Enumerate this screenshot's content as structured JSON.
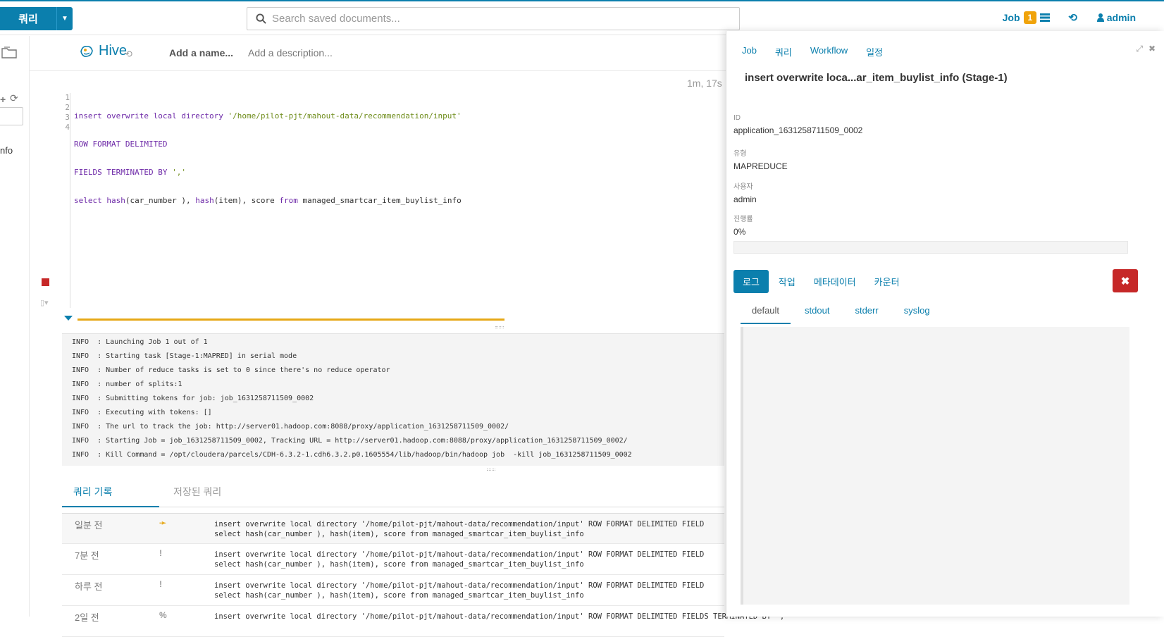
{
  "navbar": {
    "query_button": "쿼리",
    "search_placeholder": "Search saved documents...",
    "jobs_label": "Job",
    "jobs_count": "1",
    "user": "admin"
  },
  "left_strip": {
    "text": "nfo"
  },
  "editor_header": {
    "app": "Hive",
    "name_placeholder": "Add a name...",
    "desc_placeholder": "Add a description...",
    "elapsed": "1m, 17s"
  },
  "editor": {
    "line_numbers": [
      "1",
      "2",
      "3",
      "4"
    ],
    "line1_kw": "insert overwrite local directory ",
    "line1_str": "'/home/pilot-pjt/mahout-data/recommendation/input'",
    "line2": "ROW FORMAT DELIMITED",
    "line3_kw": "FIELDS TERMINATED BY ",
    "line3_str": "','",
    "line4_kw": "select ",
    "line4_fn1": "hash",
    "line4_a": "(car_number ), ",
    "line4_fn2": "hash",
    "line4_b": "(item), score ",
    "line4_kw2": "from",
    "line4_c": " managed_smartcar_item_buylist_info"
  },
  "log_lines": [
    "INFO  : Launching Job 1 out of 1",
    "INFO  : Starting task [Stage-1:MAPRED] in serial mode",
    "INFO  : Number of reduce tasks is set to 0 since there's no reduce operator",
    "INFO  : number of splits:1",
    "INFO  : Submitting tokens for job: job_1631258711509_0002",
    "INFO  : Executing with tokens: []",
    "INFO  : The url to track the job: http://server01.hadoop.com:8088/proxy/application_1631258711509_0002/",
    "INFO  : Starting Job = job_1631258711509_0002, Tracking URL = http://server01.hadoop.com:8088/proxy/application_1631258711509_0002/",
    "INFO  : Kill Command = /opt/cloudera/parcels/CDH-6.3.2-1.cdh6.3.2.p0.1605554/lib/hadoop/bin/hadoop job  -kill job_1631258711509_0002"
  ],
  "history_tabs": {
    "active": "쿼리 기록",
    "inactive": "저장된 쿼리"
  },
  "history": [
    {
      "when": "일분 전",
      "status": "➛",
      "status_color": "#e6a817",
      "line1": "insert overwrite local directory '/home/pilot-pjt/mahout-data/recommendation/input' ROW FORMAT DELIMITED FIELD",
      "line2": "select hash(car_number ), hash(item), score from managed_smartcar_item_buylist_info"
    },
    {
      "when": "7분 전",
      "status": "!",
      "status_color": "#999999",
      "line1": "insert overwrite local directory '/home/pilot-pjt/mahout-data/recommendation/input' ROW FORMAT DELIMITED FIELD",
      "line2": "select hash(car_number ), hash(item), score from managed_smartcar_item_buylist_info"
    },
    {
      "when": "하루 전",
      "status": "!",
      "status_color": "#999999",
      "line1": "insert overwrite local directory '/home/pilot-pjt/mahout-data/recommendation/input' ROW FORMAT DELIMITED FIELD",
      "line2": "select hash(car_number ), hash(item), score from managed_smartcar_item_buylist_info"
    },
    {
      "when": "2일 전",
      "status": "%",
      "status_color": "#999999",
      "line1": "insert overwrite local directory '/home/pilot-pjt/mahout-data/recommendation/input' ROW FORMAT DELIMITED FIELDS TERMINATED BY ','",
      "line2": ""
    }
  ],
  "job_panel": {
    "tabs": [
      "Job",
      "쿼리",
      "Workflow",
      "일정"
    ],
    "title": "insert overwrite loca...ar_item_buylist_info (Stage-1)",
    "id_label": "ID",
    "id_value": "application_1631258711509_0002",
    "type_label": "유형",
    "type_value": "MAPREDUCE",
    "user_label": "사용자",
    "user_value": "admin",
    "progress_label": "진행률",
    "progress_value": "0%",
    "progress_fraction": 0,
    "log_tabs": {
      "active": "로그",
      "others": [
        "작업",
        "메타데이터",
        "카운터"
      ]
    },
    "output_tabs": {
      "active": "default",
      "others": [
        "stdout",
        "stderr",
        "syslog"
      ]
    }
  },
  "colors": {
    "accent": "#0b7fad",
    "warning": "#e6a817",
    "danger": "#c62828"
  }
}
